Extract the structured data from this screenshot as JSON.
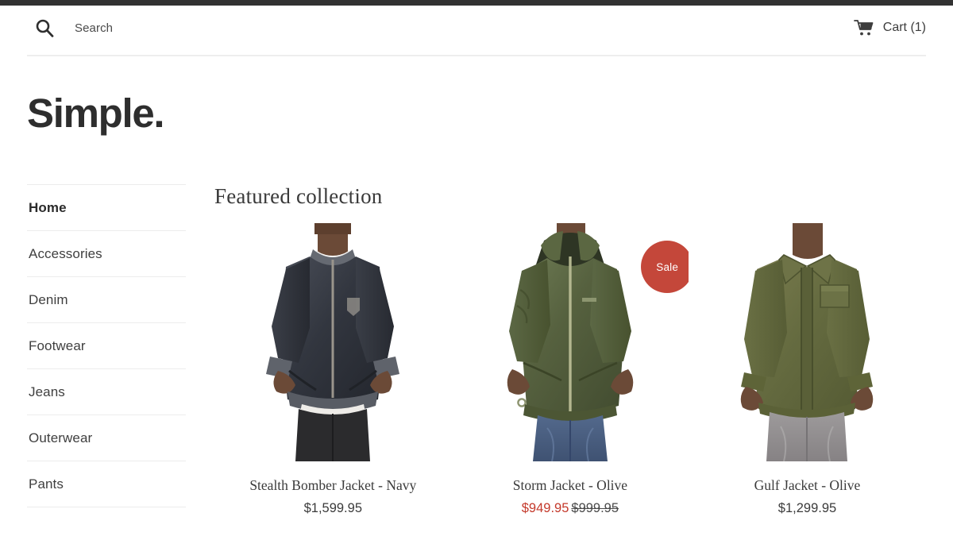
{
  "header": {
    "search": {
      "icon": "search-icon",
      "label": "Search"
    },
    "cart": {
      "icon": "cart-icon",
      "label": "Cart (1)"
    }
  },
  "brand": {
    "name": "Simple."
  },
  "sidebar": {
    "items": [
      {
        "label": "Home",
        "active": true
      },
      {
        "label": "Accessories",
        "active": false
      },
      {
        "label": "Denim",
        "active": false
      },
      {
        "label": "Footwear",
        "active": false
      },
      {
        "label": "Jeans",
        "active": false
      },
      {
        "label": "Outerwear",
        "active": false
      },
      {
        "label": "Pants",
        "active": false
      }
    ]
  },
  "main": {
    "section_title": "Featured collection",
    "products": [
      {
        "title": "Stealth Bomber Jacket - Navy",
        "price": "$1,599.95",
        "compare_at": "",
        "on_sale": false,
        "badge": "",
        "image_alt": "model wearing dark navy bomber jacket with black jeans"
      },
      {
        "title": "Storm Jacket - Olive",
        "price": "$949.95",
        "compare_at": "$999.95",
        "on_sale": true,
        "badge": "Sale",
        "image_alt": "model wearing olive hooded windbreaker with blue jeans"
      },
      {
        "title": "Gulf Jacket - Olive",
        "price": "$1,299.95",
        "compare_at": "",
        "on_sale": false,
        "badge": "",
        "image_alt": "model wearing olive overshirt with grey jeans"
      }
    ]
  },
  "colors": {
    "topbar": "#323232",
    "sale_red": "#c4392b",
    "badge_red": "#c4473a",
    "text": "#3b3b3b",
    "rule": "#ececec"
  }
}
